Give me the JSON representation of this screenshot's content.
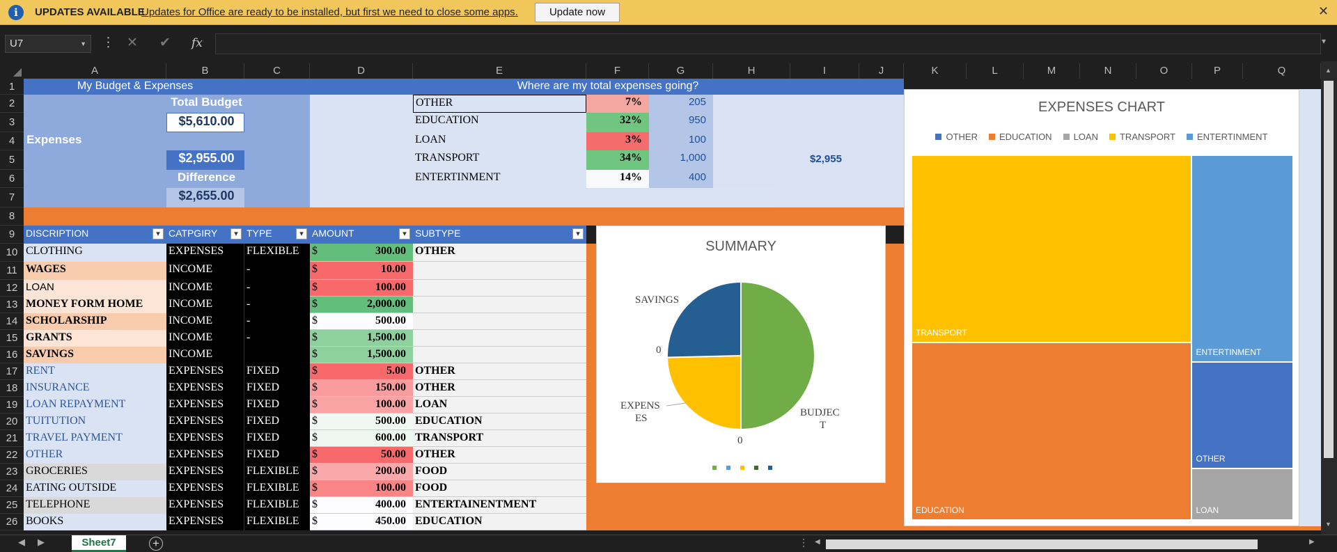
{
  "update_bar": {
    "title": "UPDATES AVAILABLE",
    "message": "Updates for Office are ready to be installed, but first we need to close some apps.",
    "button": "Update now"
  },
  "formula_bar": {
    "name_box": "U7",
    "fx": "fx",
    "value": ""
  },
  "columns": [
    "A",
    "B",
    "C",
    "D",
    "E",
    "F",
    "G",
    "H",
    "I",
    "J",
    "K",
    "L",
    "M",
    "N",
    "O",
    "P",
    "Q"
  ],
  "rows": [
    "1",
    "2",
    "3",
    "4",
    "5",
    "6",
    "7",
    "8",
    "9",
    "10",
    "11",
    "12",
    "13",
    "14",
    "15",
    "16",
    "17",
    "18",
    "19",
    "20",
    "21",
    "22",
    "23",
    "24",
    "25",
    "26"
  ],
  "budget": {
    "title": "My Budget & Expenses",
    "total_budget_label": "Total Budget",
    "total_budget": "$5,610.00",
    "total_expenses_label": "Total Expenses",
    "total_expenses": "$2,955.00",
    "difference_label": "Difference",
    "difference": "$2,655.00"
  },
  "expense_breakdown": {
    "title": "Where are my total expenses going?",
    "total": "$2,955",
    "items": [
      {
        "name": "OTHER",
        "pct": "7%",
        "amount": "205"
      },
      {
        "name": "EDUCATION",
        "pct": "32%",
        "amount": "950"
      },
      {
        "name": "LOAN",
        "pct": "3%",
        "amount": "100"
      },
      {
        "name": "TRANSPORT",
        "pct": "34%",
        "amount": "1,000"
      },
      {
        "name": "ENTERTINMENT",
        "pct": "14%",
        "amount": "400"
      }
    ]
  },
  "table": {
    "headers": [
      "DISCRIPTION",
      "CATPGIRY",
      "TYPE",
      "AMOUNT",
      "SUBTYPE"
    ],
    "currency": "$",
    "rows": [
      {
        "desc": "CLOTHING",
        "cat": "EXPENSES",
        "type": "FLEXIBLE",
        "amount": "300.00",
        "sub": "OTHER"
      },
      {
        "desc": "WAGES",
        "cat": "INCOME",
        "type": "-",
        "amount": "10.00",
        "sub": ""
      },
      {
        "desc": "LOAN",
        "cat": "INCOME",
        "type": "-",
        "amount": "100.00",
        "sub": ""
      },
      {
        "desc": "MONEY FORM HOME",
        "cat": "INCOME",
        "type": "-",
        "amount": "2,000.00",
        "sub": ""
      },
      {
        "desc": "SCHOLARSHIP",
        "cat": "INCOME",
        "type": "-",
        "amount": "500.00",
        "sub": ""
      },
      {
        "desc": "GRANTS",
        "cat": "INCOME",
        "type": "-",
        "amount": "1,500.00",
        "sub": ""
      },
      {
        "desc": "SAVINGS",
        "cat": "INCOME",
        "type": "",
        "amount": "1,500.00",
        "sub": ""
      },
      {
        "desc": "RENT",
        "cat": "EXPENSES",
        "type": "FIXED",
        "amount": "5.00",
        "sub": "OTHER"
      },
      {
        "desc": "INSURANCE",
        "cat": "EXPENSES",
        "type": "FIXED",
        "amount": "150.00",
        "sub": "OTHER"
      },
      {
        "desc": "LOAN REPAYMENT",
        "cat": "EXPENSES",
        "type": "FIXED",
        "amount": "100.00",
        "sub": "LOAN"
      },
      {
        "desc": "TUITUTION",
        "cat": "EXPENSES",
        "type": "FIXED",
        "amount": "500.00",
        "sub": "EDUCATION"
      },
      {
        "desc": "TRAVEL PAYMENT",
        "cat": "EXPENSES",
        "type": "FIXED",
        "amount": "600.00",
        "sub": "TRANSPORT"
      },
      {
        "desc": "OTHER",
        "cat": "EXPENSES",
        "type": "FIXED",
        "amount": "50.00",
        "sub": "OTHER"
      },
      {
        "desc": "GROCERIES",
        "cat": "EXPENSES",
        "type": "FLEXIBLE",
        "amount": "200.00",
        "sub": "FOOD"
      },
      {
        "desc": "EATING OUTSIDE",
        "cat": "EXPENSES",
        "type": "FLEXIBLE",
        "amount": "100.00",
        "sub": "FOOD"
      },
      {
        "desc": "TELEPHONE",
        "cat": "EXPENSES",
        "type": "FLEXIBLE",
        "amount": "400.00",
        "sub": "ENTERTAINENTMENT"
      },
      {
        "desc": "BOOKS",
        "cat": "EXPENSES",
        "type": "FLEXIBLE",
        "amount": "450.00",
        "sub": "EDUCATION"
      }
    ]
  },
  "sheet_tabs": [
    "Sheet7"
  ],
  "colors": {
    "accent": "#4472c4",
    "orange": "#ed7d31",
    "green": "#70ad47",
    "yellow": "#ffc000",
    "gray": "#a5a5a5",
    "lightblue": "#5b9bd5",
    "navy": "#255e91"
  },
  "chart_data": [
    {
      "type": "pie",
      "title": "SUMMARY",
      "series": [
        {
          "values": [
            2955,
            1455,
            1500
          ]
        }
      ],
      "categories": [
        "BUDJECT",
        "EXPENSES",
        "SAVINGS"
      ],
      "data_labels": [
        "0",
        "0"
      ]
    },
    {
      "type": "treemap",
      "title": "EXPENSES CHART",
      "legend_position": "top",
      "legend": [
        "OTHER",
        "EDUCATION",
        "LOAN",
        "TRANSPORT",
        "ENTERTINMENT"
      ],
      "categories": [
        "TRANSPORT",
        "EDUCATION",
        "ENTERTINMENT",
        "OTHER",
        "LOAN"
      ],
      "values": [
        1000,
        950,
        400,
        205,
        100
      ]
    }
  ]
}
